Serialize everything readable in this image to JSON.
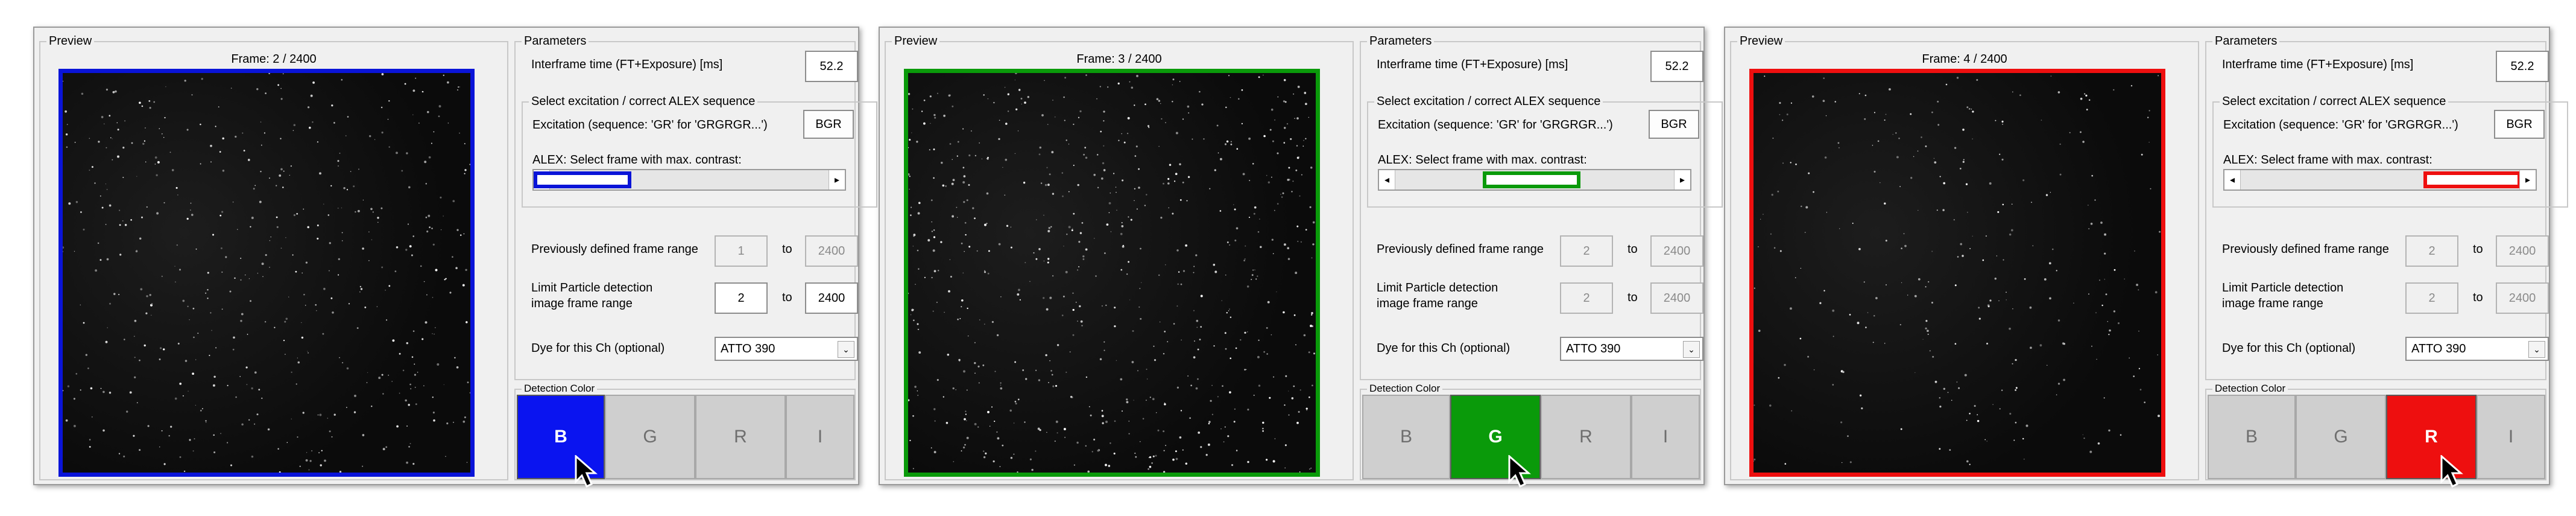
{
  "panels": [
    {
      "preview_title": "Preview",
      "frame_label": "Frame: 2 / 2400",
      "accent": "#0a14d8",
      "params_title": "Parameters",
      "interframe_label": "Interframe time (FT+Exposure) [ms]",
      "interframe_value": "52.2",
      "alex_group_title": "Select excitation / correct ALEX sequence",
      "excitation_label": "Excitation (sequence: 'GR' for 'GRGRGR...')",
      "excitation_value": "BGR",
      "alex_slider_label": "ALEX: Select frame with max. contrast:",
      "slider_fraction": 0.0,
      "prev_range_label": "Previously defined frame range",
      "prev_from": "1",
      "prev_to": "2400",
      "to_label": "to",
      "limit_label_line1": "Limit Particle detection",
      "limit_label_line2": "image frame range",
      "limit_from": "2",
      "limit_to": "2400",
      "limit_enabled": true,
      "dye_label": "Dye for this Ch (optional)",
      "dye_value": "ATTO 390",
      "detection_title": "Detection Color",
      "buttons": [
        "B",
        "G",
        "R",
        "I"
      ],
      "active_index": 0
    },
    {
      "preview_title": "Preview",
      "frame_label": "Frame: 3 / 2400",
      "accent": "#0a9a0a",
      "params_title": "Parameters",
      "interframe_label": "Interframe time (FT+Exposure) [ms]",
      "interframe_value": "52.2",
      "alex_group_title": "Select excitation / correct ALEX sequence",
      "excitation_label": "Excitation (sequence: 'GR' for 'GRGRGR...')",
      "excitation_value": "BGR",
      "alex_slider_label": "ALEX: Select frame with max. contrast:",
      "slider_fraction": 0.5,
      "prev_range_label": "Previously defined frame range",
      "prev_from": "2",
      "prev_to": "2400",
      "to_label": "to",
      "limit_label_line1": "Limit Particle detection",
      "limit_label_line2": "image frame range",
      "limit_from": "2",
      "limit_to": "2400",
      "limit_enabled": false,
      "dye_label": "Dye for this Ch (optional)",
      "dye_value": "ATTO 390",
      "detection_title": "Detection Color",
      "buttons": [
        "B",
        "G",
        "R",
        "I"
      ],
      "active_index": 1
    },
    {
      "preview_title": "Preview",
      "frame_label": "Frame: 4 / 2400",
      "accent": "#ee0f0f",
      "params_title": "Parameters",
      "interframe_label": "Interframe time (FT+Exposure) [ms]",
      "interframe_value": "52.2",
      "alex_group_title": "Select excitation / correct ALEX sequence",
      "excitation_label": "Excitation (sequence: 'GR' for 'GRGRGR...')",
      "excitation_value": "BGR",
      "alex_slider_label": "ALEX: Select frame with max. contrast:",
      "slider_fraction": 1.0,
      "prev_range_label": "Previously defined frame range",
      "prev_from": "2",
      "prev_to": "2400",
      "to_label": "to",
      "limit_label_line1": "Limit Particle detection",
      "limit_label_line2": "image frame range",
      "limit_from": "2",
      "limit_to": "2400",
      "limit_enabled": false,
      "dye_label": "Dye for this Ch (optional)",
      "dye_value": "ATTO 390",
      "detection_title": "Detection Color",
      "buttons": [
        "B",
        "G",
        "R",
        "I"
      ],
      "active_index": 2
    }
  ],
  "icons": {
    "slider_left": "◂",
    "slider_right": "▸",
    "dropdown": "⌄",
    "cursor": "cursor-arrow-icon"
  }
}
